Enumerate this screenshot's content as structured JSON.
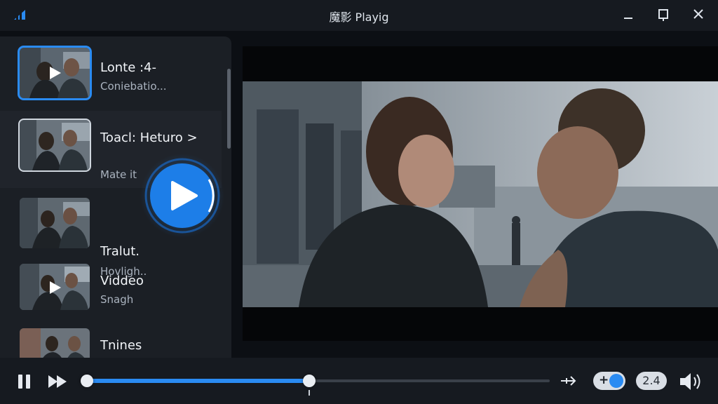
{
  "window": {
    "title": "魔影 Playig"
  },
  "playlist": [
    {
      "title": "Lonte :4-",
      "subtitle": "Coniebatio..."
    },
    {
      "title": "Toacl: Heturo >",
      "subtitle": "Mate it"
    },
    {
      "title": "Tralut.",
      "subtitle": "Hovligh.."
    },
    {
      "title": "Viddeo",
      "subtitle": "Snagh"
    },
    {
      "title": "Tnines",
      "subtitle": ""
    }
  ],
  "player": {
    "progress": 0.48,
    "speed_label": "2.4",
    "toggle_label": "+"
  },
  "colors": {
    "accent": "#2a8bf2",
    "panel": "#1b1f25",
    "bar": "#161a20"
  },
  "icons": [
    "app-logo-icon",
    "minimize-icon",
    "maximize-icon",
    "close-icon",
    "play-icon",
    "pause-icon",
    "fast-forward-icon",
    "skip-icon",
    "volume-icon"
  ]
}
